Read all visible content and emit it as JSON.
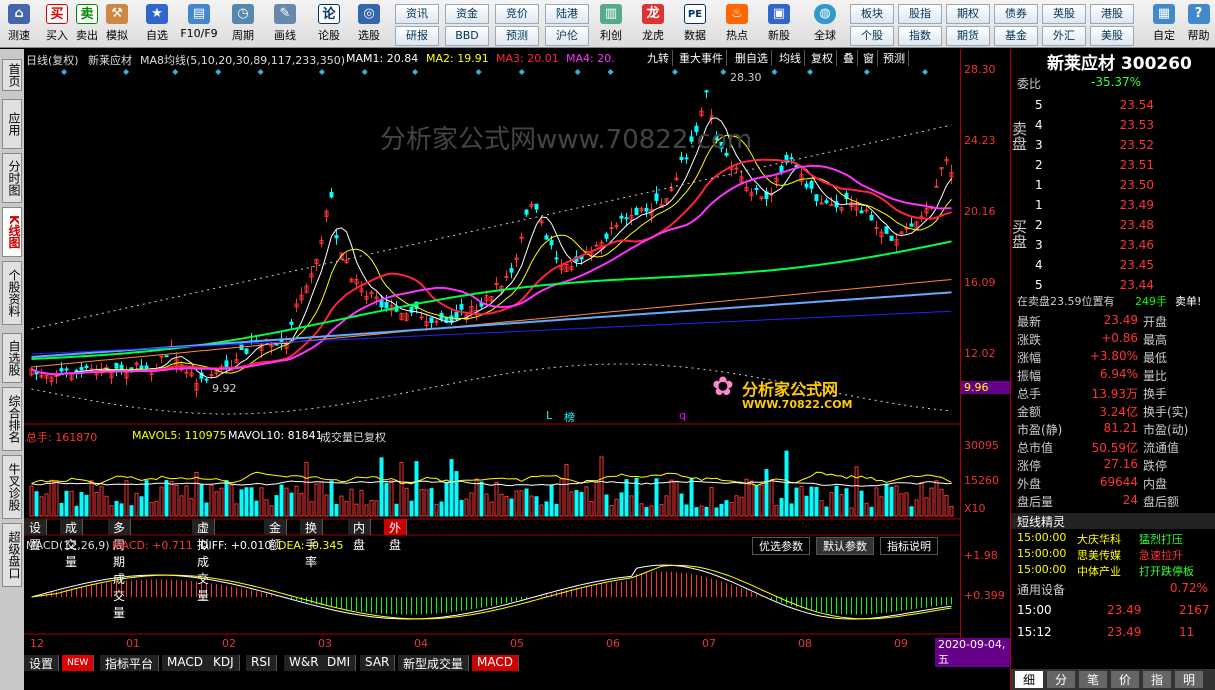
{
  "toolbar": {
    "items": [
      {
        "label": "测速",
        "icon": "speed"
      },
      {
        "label": "买入",
        "icon": "买"
      },
      {
        "label": "卖出",
        "icon": "卖"
      },
      {
        "label": "模拟",
        "icon": "hammer"
      },
      {
        "label": "自选",
        "icon": "star"
      },
      {
        "label": "F10/F9",
        "icon": "doc"
      },
      {
        "label": "周期",
        "icon": "clock"
      },
      {
        "label": "画线",
        "icon": "pen"
      },
      {
        "label": "论股",
        "icon": "论"
      },
      {
        "label": "选股",
        "icon": "pick"
      }
    ],
    "mini": [
      "资讯",
      "资金",
      "竞价",
      "陆港",
      "研报",
      "BBD",
      "预测",
      "沪伦"
    ],
    "big": [
      {
        "label": "利创",
        "icon": "chart"
      },
      {
        "label": "龙虎",
        "icon": "dragon"
      },
      {
        "label": "数据",
        "icon": "PE"
      },
      {
        "label": "热点",
        "icon": "hot"
      },
      {
        "label": "新股",
        "icon": "new"
      },
      {
        "label": "全球",
        "icon": "globe"
      }
    ],
    "mini2": [
      "板块",
      "股指",
      "期权",
      "债券",
      "英股",
      "港股",
      "个股",
      "指数",
      "期货",
      "基金",
      "外汇",
      "美股"
    ],
    "right": [
      {
        "label": "自定",
        "icon": "custom"
      },
      {
        "label": "帮助",
        "icon": "help"
      }
    ]
  },
  "left_tabs": [
    "首页",
    "应用",
    "分时图",
    "K线图",
    "个股资料",
    "自选股",
    "综合排名",
    "牛叉诊股",
    "超级盘口"
  ],
  "chart_header": {
    "period": "日线(复权)",
    "name": "新莱应材",
    "ma_name": "MA8均线(5,10,20,30,89,117,233,350)",
    "ma1": "MAM1: 20.84",
    "ma2": "MA2: 19.91",
    "ma3": "MA3: 20.01",
    "ma4": "MA4: 20.",
    "right_btns": [
      "九转",
      "重大事件",
      "删自选",
      "均线",
      "复权",
      "叠",
      "窗",
      "预测"
    ]
  },
  "price_labels": {
    "high": "28.30",
    "low": "9.92",
    "lbl_letters": [
      "L",
      "榜",
      "q"
    ]
  },
  "watermark": "分析家公式网www.70822.com",
  "logo": {
    "cn": "分析家公式网",
    "url": "WWW.70822.COM"
  },
  "axis": {
    "price": [
      "28.30",
      "24.23",
      "20.16",
      "16.09",
      "12.02"
    ],
    "last": "9.96",
    "vol": [
      "30095",
      "15260",
      "X10"
    ],
    "macd": [
      "+1.98",
      "+0.399"
    ]
  },
  "vol_header": {
    "total": "总手: 161870",
    "mavol5": "MAVOL5: 110975",
    "mavol10": "MAVOL10: 81841",
    "note": "成交量已复权"
  },
  "sub_tabs": [
    "设置",
    "成交量",
    "多周期成交量",
    "虚拟成交量",
    "金额",
    "换手率",
    "内盘",
    "外盘"
  ],
  "macd_header": {
    "name": "MACD(12,26,9)",
    "macd": "MACD: +0.711",
    "diff": "DIFF: +0.010",
    "dea": "DEA: -0.345",
    "btns": [
      "优选参数",
      "默认参数",
      "指标说明"
    ]
  },
  "months": [
    "12",
    "01",
    "02",
    "03",
    "04",
    "05",
    "06",
    "07",
    "08",
    "09"
  ],
  "date": "2020-09-04,五",
  "bottom_tabs": [
    "设置",
    "NEW",
    "指标平台",
    "MACD",
    "KDJ",
    "RSI",
    "W&R",
    "DMI",
    "SAR",
    "新型成交量",
    "MACD"
  ],
  "right_panel": {
    "title": "新莱应材 300260",
    "weibi": {
      "label": "委比",
      "value": "-35.37%"
    },
    "sell_label": "卖盘",
    "buy_label": "买盘",
    "sell": [
      {
        "n": "5",
        "p": "23.54"
      },
      {
        "n": "4",
        "p": "23.53"
      },
      {
        "n": "3",
        "p": "23.52"
      },
      {
        "n": "2",
        "p": "23.51"
      },
      {
        "n": "1",
        "p": "23.50"
      }
    ],
    "buy": [
      {
        "n": "1",
        "p": "23.49"
      },
      {
        "n": "2",
        "p": "23.48"
      },
      {
        "n": "3",
        "p": "23.46"
      },
      {
        "n": "4",
        "p": "23.45"
      },
      {
        "n": "5",
        "p": "23.44"
      }
    ],
    "trade": {
      "text": "在卖盘23.59位置有",
      "vol": "249手",
      "act": "卖单!"
    },
    "stats": [
      {
        "l": "最新",
        "v": "23.49",
        "r": "开盘"
      },
      {
        "l": "涨跌",
        "v": "+0.86",
        "r": "最高"
      },
      {
        "l": "涨幅",
        "v": "+3.80%",
        "r": "最低"
      },
      {
        "l": "振幅",
        "v": "6.94%",
        "r": "量比"
      },
      {
        "l": "总手",
        "v": "13.93万",
        "r": "换手"
      },
      {
        "l": "金额",
        "v": "3.24亿",
        "r": "换手(实)"
      },
      {
        "l": "市盈(静)",
        "v": "81.21",
        "r": "市盈(动)"
      },
      {
        "l": "总市值",
        "v": "50.59亿",
        "r": "流通值"
      },
      {
        "l": "涨停",
        "v": "27.16",
        "r": "跌停"
      },
      {
        "l": "外盘",
        "v": "69644",
        "r": "内盘"
      },
      {
        "l": "盘后量",
        "v": "24",
        "r": "盘后额"
      }
    ],
    "short_title": "短线精灵",
    "short": [
      {
        "t": "15:00:00",
        "s": "大庆华科",
        "a": "猛烈打压"
      },
      {
        "t": "15:00:00",
        "s": "思美传媒",
        "a": "急速拉升"
      },
      {
        "t": "15:00:00",
        "s": "中体产业",
        "a": "打开跌停板"
      }
    ],
    "industry": {
      "name": "通用设备",
      "pct": "0.72%"
    },
    "ticks": [
      {
        "t": "15:00",
        "p": "23.49",
        "v": "2167"
      },
      {
        "t": "15:12",
        "p": "23.49",
        "v": "11"
      }
    ],
    "bottom": [
      "细",
      "分",
      "笔",
      "价",
      "指",
      "明"
    ]
  },
  "colors": {
    "up": "#ff3333",
    "down": "#00ffff",
    "ma1": "#ffffff",
    "ma2": "#ffff00",
    "ma3": "#ff2244",
    "ma4": "#ff33ff",
    "ma5": "#00ff44",
    "ma6": "#ff8844",
    "ma7": "#66aaff",
    "ma8": "#2222ff"
  }
}
